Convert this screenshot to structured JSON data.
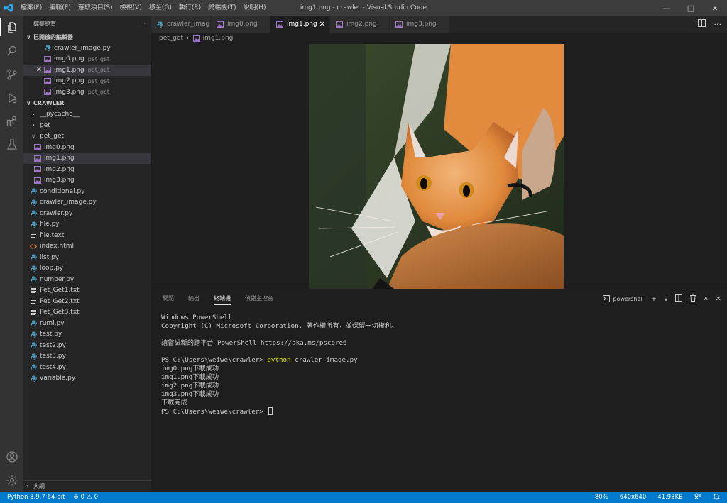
{
  "window": {
    "title": "img1.png - crawler - Visual Studio Code",
    "menu": [
      "檔案(F)",
      "編輯(E)",
      "選取項目(S)",
      "檢視(V)",
      "移至(G)",
      "執行(R)",
      "終端機(T)",
      "說明(H)"
    ]
  },
  "sidebar": {
    "title": "檔案總管",
    "more": "···",
    "open_editors_header": "已開啟的編輯器",
    "open_editors": [
      {
        "name": "crawler_image.py",
        "desc": "",
        "type": "py"
      },
      {
        "name": "img0.png",
        "desc": "pet_get",
        "type": "png"
      },
      {
        "name": "img1.png",
        "desc": "pet_get",
        "type": "png"
      },
      {
        "name": "img2.png",
        "desc": "pet_get",
        "type": "png"
      },
      {
        "name": "img3.png",
        "desc": "pet_get",
        "type": "png"
      }
    ],
    "project_header": "CRAWLER",
    "tree": [
      {
        "name": "__pycache__",
        "type": "folder",
        "depth": 0
      },
      {
        "name": "pet",
        "type": "folder",
        "depth": 0
      },
      {
        "name": "pet_get",
        "type": "folder-open",
        "depth": 0
      },
      {
        "name": "img0.png",
        "type": "png",
        "depth": 1
      },
      {
        "name": "img1.png",
        "type": "png",
        "depth": 1
      },
      {
        "name": "img2.png",
        "type": "png",
        "depth": 1
      },
      {
        "name": "img3.png",
        "type": "png",
        "depth": 1
      },
      {
        "name": "conditional.py",
        "type": "py",
        "depth": 0
      },
      {
        "name": "crawler_image.py",
        "type": "py",
        "depth": 0
      },
      {
        "name": "crawler.py",
        "type": "py",
        "depth": 0
      },
      {
        "name": "file.py",
        "type": "py",
        "depth": 0
      },
      {
        "name": "file.text",
        "type": "txt",
        "depth": 0
      },
      {
        "name": "index.html",
        "type": "html",
        "depth": 0
      },
      {
        "name": "list.py",
        "type": "py",
        "depth": 0
      },
      {
        "name": "loop.py",
        "type": "py",
        "depth": 0
      },
      {
        "name": "number.py",
        "type": "py",
        "depth": 0
      },
      {
        "name": "Pet_Get1.txt",
        "type": "txt",
        "depth": 0
      },
      {
        "name": "Pet_Get2.txt",
        "type": "txt",
        "depth": 0
      },
      {
        "name": "Pet_Get3.txt",
        "type": "txt",
        "depth": 0
      },
      {
        "name": "rumi.py",
        "type": "py",
        "depth": 0
      },
      {
        "name": "test.py",
        "type": "py",
        "depth": 0
      },
      {
        "name": "test2.py",
        "type": "py",
        "depth": 0
      },
      {
        "name": "test3.py",
        "type": "py",
        "depth": 0
      },
      {
        "name": "test4.py",
        "type": "py",
        "depth": 0
      },
      {
        "name": "variable.py",
        "type": "py",
        "depth": 0
      }
    ],
    "outline_header": "大綱"
  },
  "tabs": [
    {
      "label": "crawler_image.py",
      "type": "py"
    },
    {
      "label": "img0.png",
      "type": "png"
    },
    {
      "label": "img1.png",
      "type": "png",
      "active": true
    },
    {
      "label": "img2.png",
      "type": "png"
    },
    {
      "label": "img3.png",
      "type": "png"
    }
  ],
  "breadcrumb": {
    "folder": "pet_get",
    "file": "img1.png"
  },
  "panel": {
    "tabs": [
      "問題",
      "輸出",
      "終端機",
      "偵錯主控台"
    ],
    "active_tab": "終端機",
    "shell_label": "powershell",
    "terminal": {
      "line1": "Windows PowerShell",
      "line2": "Copyright (C) Microsoft Corporation. 著作權所有，並保留一切權利。",
      "line3": "請嘗試新的跨平台 PowerShell https://aka.ms/pscore6",
      "prompt": "PS C:\\Users\\weiwe\\crawler>",
      "command": "python",
      "command_arg": "crawler_image.py",
      "out1": "img0.png下載成功",
      "out2": "img1.png下載成功",
      "out3": "img2.png下載成功",
      "out4": "img3.png下載成功",
      "out5": "下載完成"
    }
  },
  "statusbar": {
    "python": "Python 3.9.7 64-bit",
    "errors": "0",
    "warnings": "0",
    "zoom": "80%",
    "dimensions": "640x640",
    "filesize": "41.93KB"
  },
  "colors": {
    "accent": "#007acc",
    "python_icon": "#519aba",
    "image_icon": "#a074c4",
    "html_icon": "#e37933"
  }
}
